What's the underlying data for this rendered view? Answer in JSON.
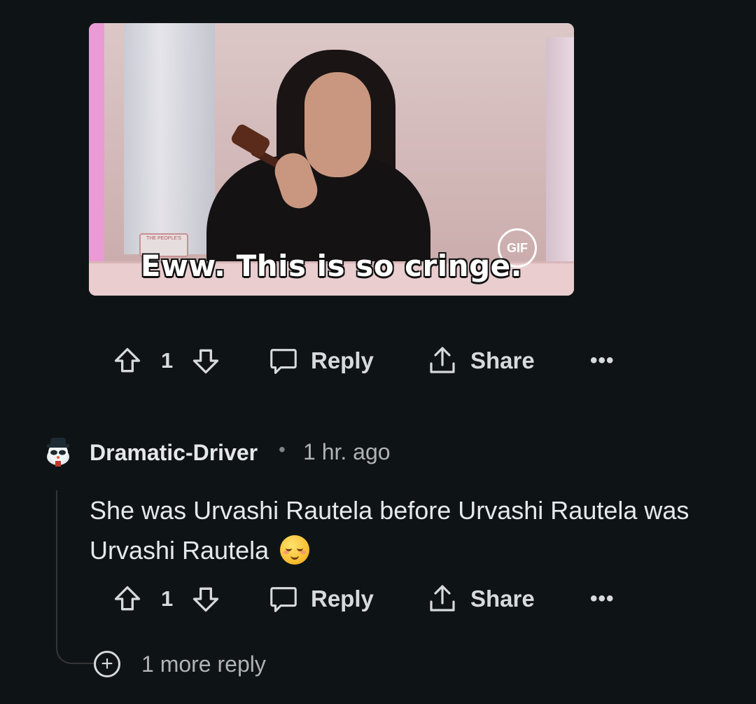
{
  "gif": {
    "caption": "Eww. This is so cringe.",
    "badge": "GIF",
    "plaque_text": "THE PEOPLE'S"
  },
  "post_actions": {
    "vote_count": "1",
    "reply_label": "Reply",
    "share_label": "Share",
    "more": "•••"
  },
  "comment": {
    "username": "Dramatic-Driver",
    "separator": "•",
    "time": "1 hr. ago",
    "body": "She was Urvashi Rautela before Urvashi Rautela was Urvashi Rautela",
    "emoji": "relieved-face",
    "actions": {
      "vote_count": "1",
      "reply_label": "Reply",
      "share_label": "Share",
      "more": "•••"
    },
    "more_replies": "1 more reply"
  },
  "colors": {
    "background": "#0e1416",
    "text": "#d7dadc",
    "muted": "#b0b3b6"
  }
}
